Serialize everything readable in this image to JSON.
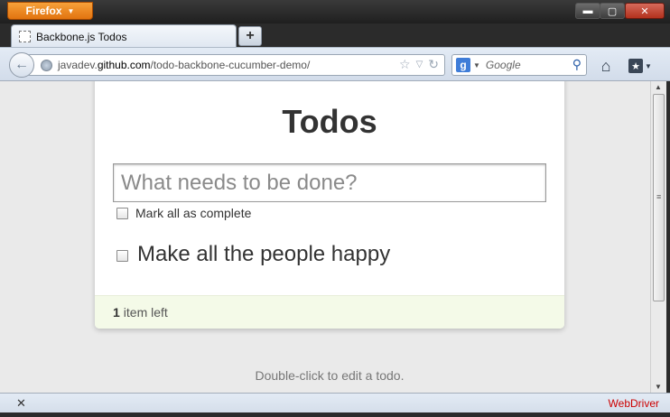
{
  "browser": {
    "menu_button_label": "Firefox",
    "window_controls": {
      "minimize": "▬",
      "maximize": "▢",
      "close": "✕"
    },
    "tab": {
      "title": "Backbone.js Todos",
      "new_tab_label": "+"
    },
    "address": {
      "url_prefix": "javadev.",
      "url_domain": "github.com",
      "url_path": "/todo-backbone-cucumber-demo/"
    },
    "search": {
      "engine_icon": "g-icon",
      "engine_letter": "g",
      "placeholder": "Google"
    },
    "icons": [
      "back-arrow-icon",
      "globe-icon",
      "star-icon",
      "dropdown-icon",
      "reload-icon",
      "search-icon",
      "home-icon",
      "bookmarks-icon"
    ]
  },
  "app": {
    "title": "Todos",
    "new_todo_placeholder": "What needs to be done?",
    "mark_all_label": "Mark all as complete",
    "todos": [
      {
        "label": "Make all the people happy",
        "completed": false
      }
    ],
    "footer": {
      "count": "1",
      "count_suffix": "item left"
    },
    "info": "Double-click to edit a todo."
  },
  "statusbar": {
    "right_text": "WebDriver",
    "right_text_color": "#cc0000"
  }
}
